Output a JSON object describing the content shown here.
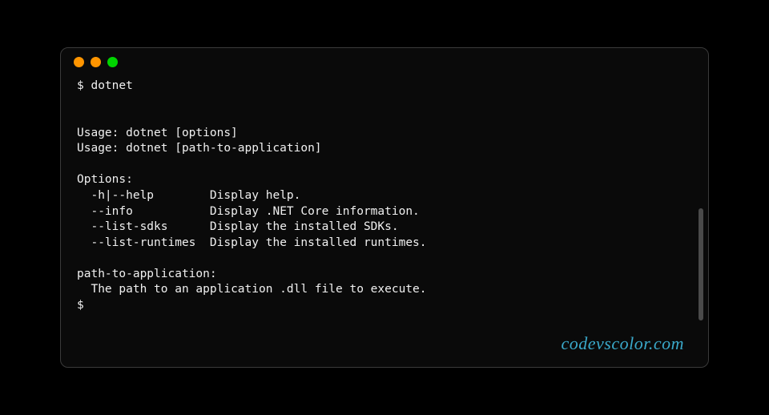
{
  "terminal": {
    "prompt": "$",
    "command": "dotnet",
    "output": {
      "usage1": "Usage: dotnet [options]",
      "usage2": "Usage: dotnet [path-to-application]",
      "options_header": "Options:",
      "options": [
        {
          "flag": "-h|--help",
          "desc": "Display help."
        },
        {
          "flag": "--info",
          "desc": "Display .NET Core information."
        },
        {
          "flag": "--list-sdks",
          "desc": "Display the installed SDKs."
        },
        {
          "flag": "--list-runtimes",
          "desc": "Display the installed runtimes."
        }
      ],
      "path_header": "path-to-application:",
      "path_desc": "The path to an application .dll file to execute."
    },
    "final_prompt": "$"
  },
  "watermark": "codevscolor.com"
}
